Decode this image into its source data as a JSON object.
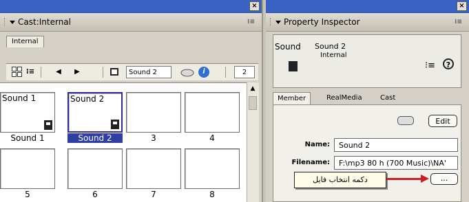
{
  "cast_panel": {
    "close_glyph": "×",
    "title": "Cast:Internal",
    "options_glyph": "⁝≡",
    "tab": "Internal",
    "toolbar": {
      "list_glyph": "⁝≡",
      "prev_glyph": "◀",
      "next_glyph": "▶",
      "member_name": "Sound 2",
      "member_number": "2",
      "info_glyph": "i"
    },
    "members": [
      {
        "name": "Sound 1",
        "label": "Sound 1",
        "selected": false,
        "has_icon": true
      },
      {
        "name": "Sound 2",
        "label": "Sound 2",
        "selected": true,
        "has_icon": true
      },
      {
        "name": "",
        "label": "3",
        "selected": false,
        "has_icon": false
      },
      {
        "name": "",
        "label": "4",
        "selected": false,
        "has_icon": false
      },
      {
        "name": "",
        "label": "5",
        "selected": false,
        "has_icon": false
      },
      {
        "name": "",
        "label": "6",
        "selected": false,
        "has_icon": false
      },
      {
        "name": "",
        "label": "7",
        "selected": false,
        "has_icon": false
      },
      {
        "name": "",
        "label": "8",
        "selected": false,
        "has_icon": false
      }
    ]
  },
  "property_inspector": {
    "close_glyph": "×",
    "title": "Property Inspector",
    "options_glyph": "⁝≡",
    "summary": {
      "type_label": "Sound",
      "member_name": "Sound 2",
      "cast_name": "Internal",
      "list_glyph": "⁝≡",
      "help_glyph": "?"
    },
    "tabs": [
      "Member",
      "RealMedia",
      "Cast"
    ],
    "edit_label": "Edit",
    "name_label": "Name:",
    "name_value": "Sound 2",
    "filename_label": "Filename:",
    "filename_value": "F:\\mp3 80 h (700 Music)\\NA'",
    "browse_label": "...",
    "callout_text": "دکمه انتخاب فایل"
  },
  "colors": {
    "titlebar": "#3a61c4",
    "selection": "#2f3fa3",
    "arrow": "#c62020",
    "callout_bg": "#fffde8"
  }
}
